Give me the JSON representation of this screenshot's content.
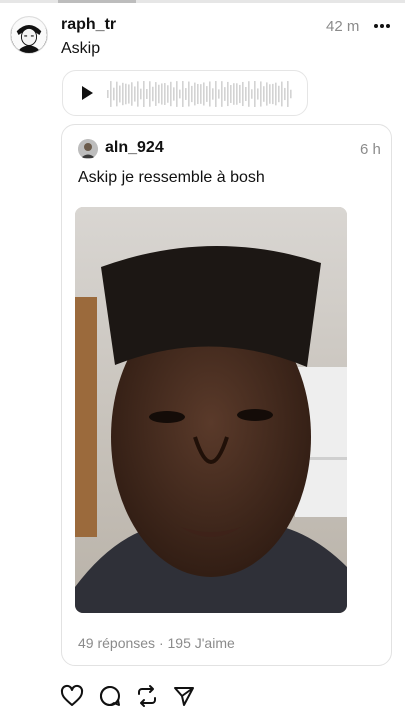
{
  "post": {
    "username": "raph_tr",
    "text": "Askip",
    "time": "42 m"
  },
  "audio": {
    "play_icon": "play-icon"
  },
  "quoted": {
    "username": "aln_924",
    "time": "6 h",
    "text": "Askip je ressemble à bosh",
    "replies": "49 réponses · 195 J'aime"
  },
  "actions": {
    "like_icon": "heart-icon",
    "comment_icon": "comment-icon",
    "repost_icon": "repost-icon",
    "share_icon": "send-icon"
  }
}
